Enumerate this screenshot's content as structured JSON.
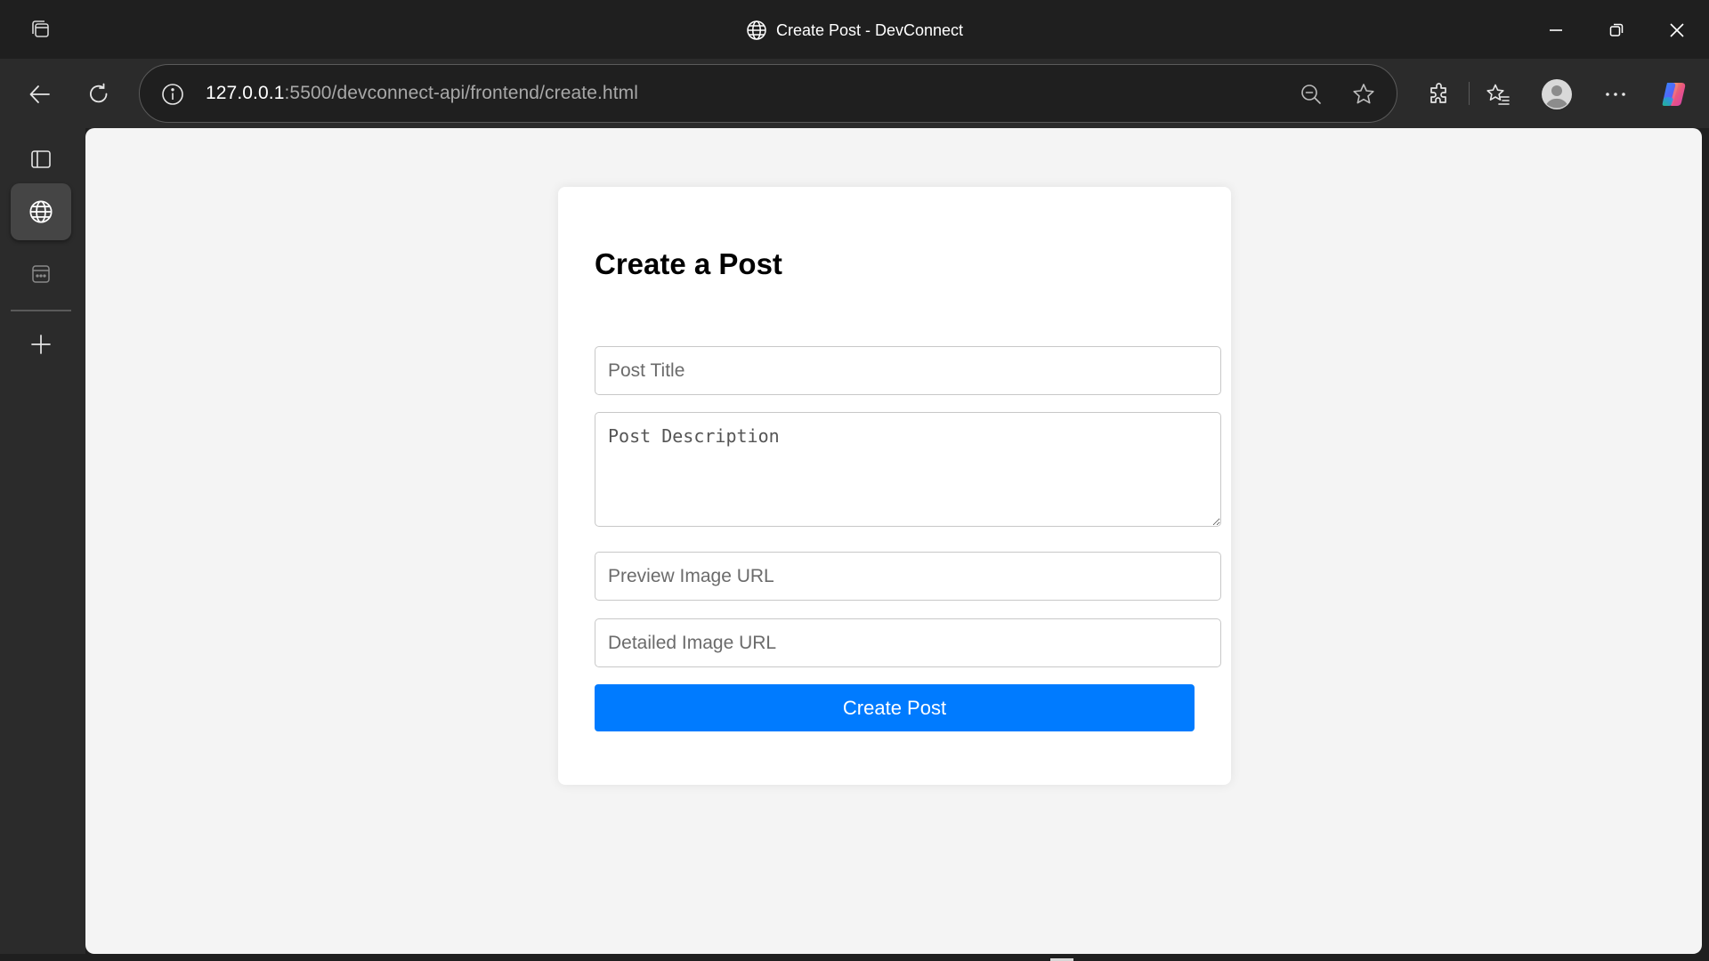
{
  "window": {
    "title": "Create Post - DevConnect",
    "title_icon": "globe-icon"
  },
  "toolbar": {
    "url_host": "127.0.0.1",
    "url_rest": ":5500/devconnect-api/frontend/create.html",
    "icons": [
      "back-arrow-icon",
      "refresh-icon",
      "info-icon",
      "zoom-out-icon",
      "favorite-star-icon",
      "extensions-icon",
      "favorites-icon",
      "profile-icon",
      "more-icon",
      "copilot-icon"
    ]
  },
  "sidebar": {
    "items": [
      "tab-actions-icon",
      "globe-icon",
      "workspace-icon",
      "add-icon"
    ],
    "active_index": 1
  },
  "form": {
    "heading": "Create a Post",
    "title_placeholder": "Post Title",
    "description_placeholder": "Post Description",
    "preview_image_placeholder": "Preview Image URL",
    "detailed_image_placeholder": "Detailed Image URL",
    "submit_label": "Create Post",
    "accent_color": "#007bff"
  }
}
